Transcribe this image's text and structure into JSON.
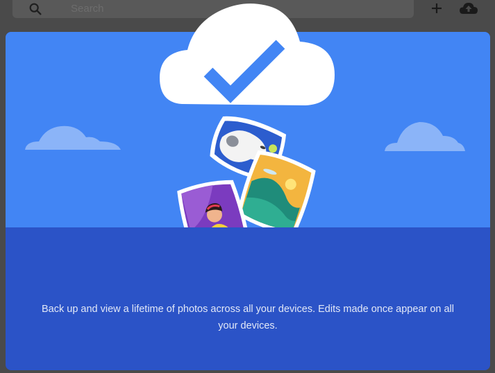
{
  "toolbar": {
    "search_placeholder": "Search",
    "icons": {
      "search": "search-icon",
      "add": "plus-icon",
      "upload": "cloud-upload-icon"
    }
  },
  "dialog": {
    "message": "Back up and view a lifetime of photos across all your devices. Edits made once appear on all your devices.",
    "illustration": {
      "main": "cloud-check-icon",
      "photos": [
        "dog-photo",
        "landscape-photo",
        "portrait-photo"
      ]
    }
  },
  "colors": {
    "hero_blue": "#4285f4",
    "footer_blue": "#2b53c7",
    "check_blue": "#4285f4",
    "cloud_white": "#ffffff",
    "topbar": "#4a4a4a"
  }
}
